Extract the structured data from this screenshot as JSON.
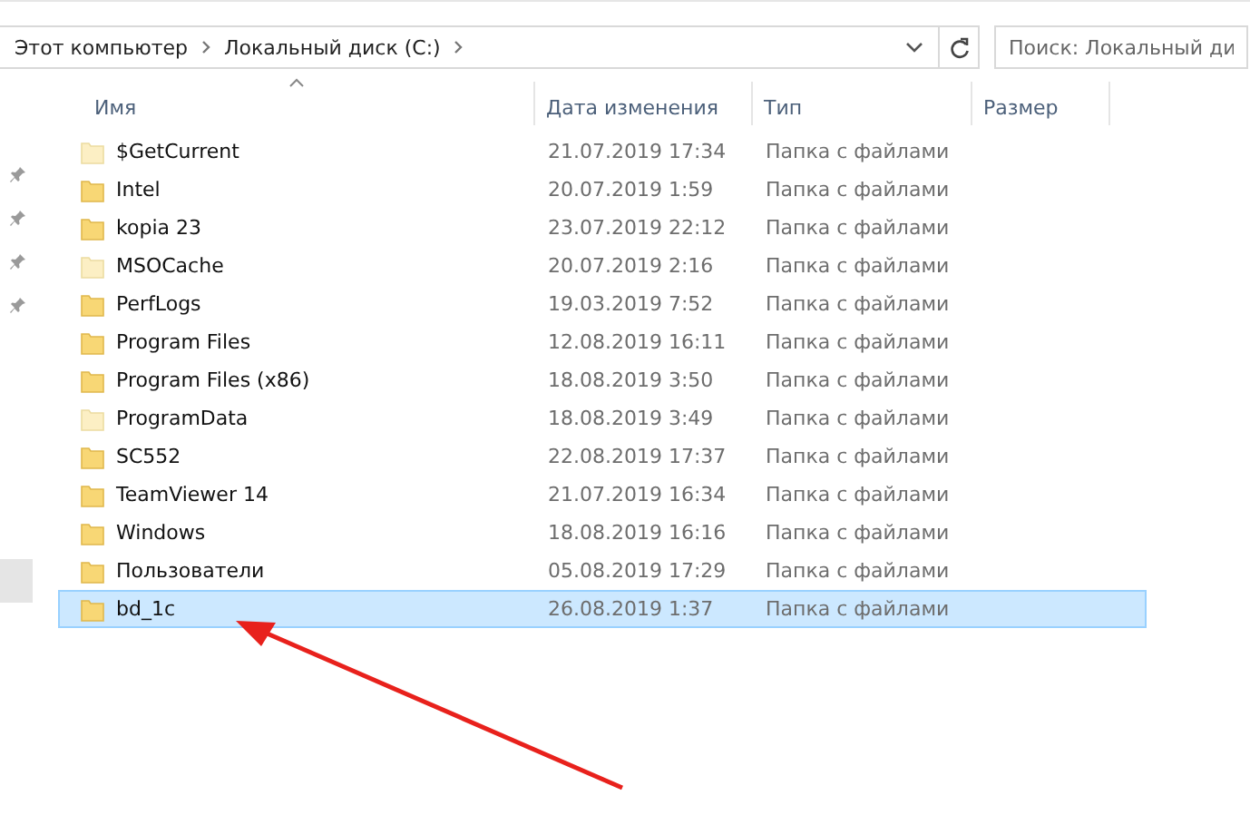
{
  "breadcrumb": [
    {
      "label": "Этот компьютер"
    },
    {
      "label": "Локальный диск (C:)"
    }
  ],
  "search": {
    "placeholder": "Поиск: Локальный ди"
  },
  "columns": [
    {
      "label": "Имя",
      "sorted": true
    },
    {
      "label": "Дата изменения",
      "sorted": false
    },
    {
      "label": "Тип",
      "sorted": false
    },
    {
      "label": "Размер",
      "sorted": false
    }
  ],
  "rows": [
    {
      "name": "$GetCurrent",
      "date": "21.07.2019 17:34",
      "type": "Папка с файлами",
      "hidden": true,
      "selected": false
    },
    {
      "name": "Intel",
      "date": "20.07.2019 1:59",
      "type": "Папка с файлами",
      "hidden": false,
      "selected": false
    },
    {
      "name": "kopia 23",
      "date": "23.07.2019 22:12",
      "type": "Папка с файлами",
      "hidden": false,
      "selected": false
    },
    {
      "name": "MSOCache",
      "date": "20.07.2019 2:16",
      "type": "Папка с файлами",
      "hidden": true,
      "selected": false
    },
    {
      "name": "PerfLogs",
      "date": "19.03.2019 7:52",
      "type": "Папка с файлами",
      "hidden": false,
      "selected": false
    },
    {
      "name": "Program Files",
      "date": "12.08.2019 16:11",
      "type": "Папка с файлами",
      "hidden": false,
      "selected": false
    },
    {
      "name": "Program Files (x86)",
      "date": "18.08.2019 3:50",
      "type": "Папка с файлами",
      "hidden": false,
      "selected": false
    },
    {
      "name": "ProgramData",
      "date": "18.08.2019 3:49",
      "type": "Папка с файлами",
      "hidden": true,
      "selected": false
    },
    {
      "name": "SC552",
      "date": "22.08.2019 17:37",
      "type": "Папка с файлами",
      "hidden": false,
      "selected": false
    },
    {
      "name": "TeamViewer 14",
      "date": "21.07.2019 16:34",
      "type": "Папка с файлами",
      "hidden": false,
      "selected": false
    },
    {
      "name": "Windows",
      "date": "18.08.2019 16:16",
      "type": "Папка с файлами",
      "hidden": false,
      "selected": false
    },
    {
      "name": "Пользователи",
      "date": "05.08.2019 17:29",
      "type": "Папка с файлами",
      "hidden": false,
      "selected": false
    },
    {
      "name": "bd_1c",
      "date": "26.08.2019 1:37",
      "type": "Папка с файлами",
      "hidden": false,
      "selected": true
    }
  ]
}
